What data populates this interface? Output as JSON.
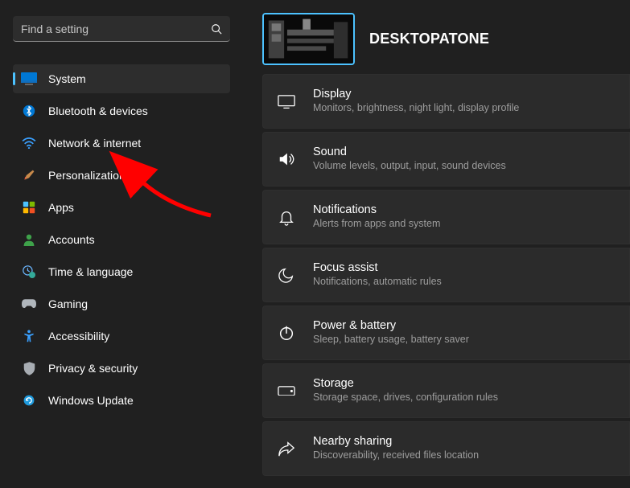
{
  "search": {
    "placeholder": "Find a setting"
  },
  "header": {
    "title": "DESKTOPATONE"
  },
  "sidebar": {
    "items": [
      {
        "label": "System"
      },
      {
        "label": "Bluetooth & devices"
      },
      {
        "label": "Network & internet"
      },
      {
        "label": "Personalization"
      },
      {
        "label": "Apps"
      },
      {
        "label": "Accounts"
      },
      {
        "label": "Time & language"
      },
      {
        "label": "Gaming"
      },
      {
        "label": "Accessibility"
      },
      {
        "label": "Privacy & security"
      },
      {
        "label": "Windows Update"
      }
    ]
  },
  "cards": [
    {
      "title": "Display",
      "sub": "Monitors, brightness, night light, display profile"
    },
    {
      "title": "Sound",
      "sub": "Volume levels, output, input, sound devices"
    },
    {
      "title": "Notifications",
      "sub": "Alerts from apps and system"
    },
    {
      "title": "Focus assist",
      "sub": "Notifications, automatic rules"
    },
    {
      "title": "Power & battery",
      "sub": "Sleep, battery usage, battery saver"
    },
    {
      "title": "Storage",
      "sub": "Storage space, drives, configuration rules"
    },
    {
      "title": "Nearby sharing",
      "sub": "Discoverability, received files location"
    }
  ]
}
